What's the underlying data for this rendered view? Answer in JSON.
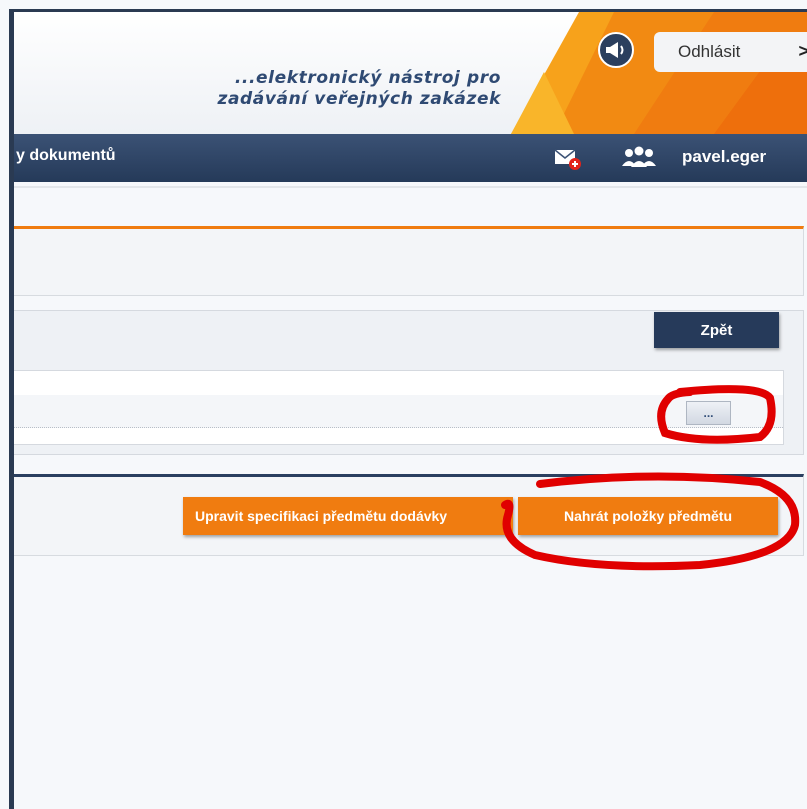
{
  "header": {
    "tagline_line1": "...elektronický nástroj pro",
    "tagline_line2": "zadávání veřejných zakázek",
    "logout_label": "Odhlásit",
    "logout_chevron": ">",
    "brand_color": "#f07c10"
  },
  "nav": {
    "partial_item": "y dokumentů",
    "username": "pavel.eger",
    "icons": [
      "mail-icon",
      "users-icon",
      "megaphone-icon"
    ]
  },
  "detail": {
    "back_label": "Zpět",
    "more_label": "..."
  },
  "actions": {
    "edit_spec_label": "Upravit specifikaci předmětu dodávky",
    "upload_items_label": "Nahrát položky předmětu"
  },
  "colors": {
    "navy": "#263a5a",
    "orange": "#f07c10",
    "annotation_red": "#e00000"
  }
}
